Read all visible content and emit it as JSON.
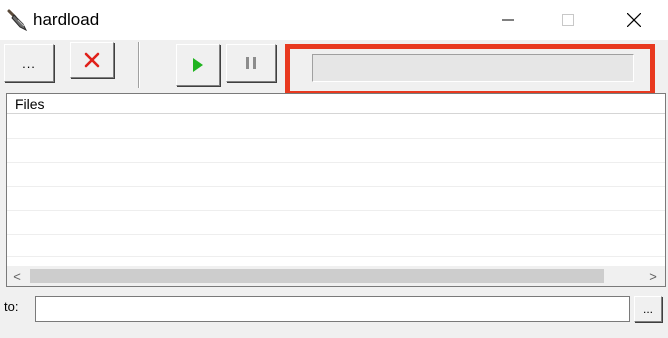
{
  "window": {
    "title": "hardload",
    "icon": "shovel-icon",
    "controls": [
      "minimize-icon",
      "maximize-icon",
      "close-icon"
    ]
  },
  "toolbar": {
    "browse_label": "...",
    "buttons": [
      {
        "name": "browse-button",
        "icon": "ellipsis-icon"
      },
      {
        "name": "delete-button",
        "icon": "red-x-icon",
        "color": "#e0201a"
      },
      {
        "name": "start-button",
        "icon": "play-icon",
        "color": "#1fb41f"
      },
      {
        "name": "pause-button",
        "icon": "pause-icon",
        "color": "#8c8c8c"
      }
    ],
    "progress": 0,
    "highlight_color": "#e8391f"
  },
  "file_list": {
    "column_header": "Files",
    "rows": []
  },
  "scrollbar": {
    "left_arrow": "<",
    "right_arrow": ">"
  },
  "destination": {
    "label": "to:",
    "value": "",
    "browse_label": "..."
  }
}
